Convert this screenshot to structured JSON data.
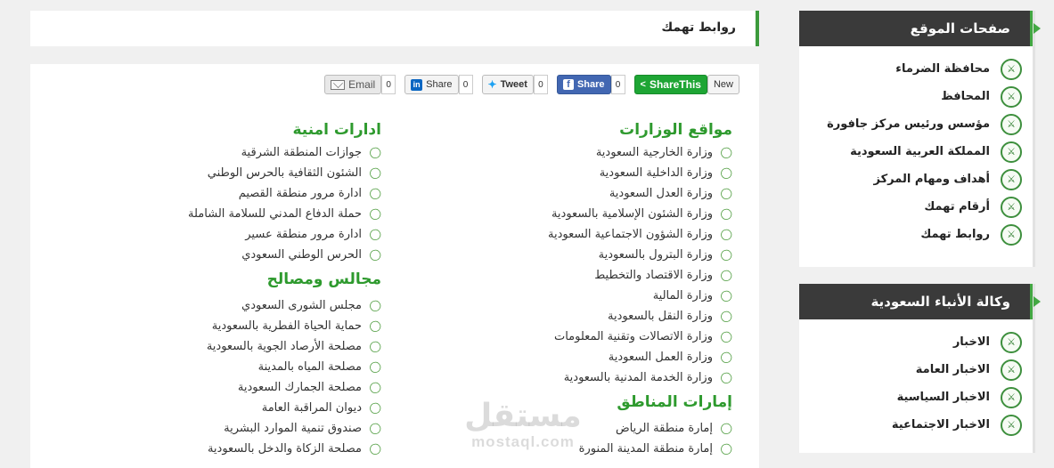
{
  "page": {
    "title": "روابط تهمك"
  },
  "share_bar": {
    "sharethis_label": "ShareThis",
    "new_label": "New",
    "facebook_label": "Share",
    "facebook_count": "0",
    "tweet_label": "Tweet",
    "tweet_count": "0",
    "linkedin_label": "Share",
    "linkedin_count": "0",
    "email_label": "Email",
    "email_count": "0"
  },
  "sections": {
    "ministries": {
      "title": "مواقع الوزارات",
      "items": [
        "وزارة الخارجية السعودية",
        "وزارة الداخلية السعودية",
        "وزارة العدل السعودية",
        "وزارة الشئون الإسلامية بالسعودية",
        "وزارة الشؤون الاجتماعية السعودية",
        "وزارة البترول بالسعودية",
        "وزارة الاقتصاد والتخطيط",
        "وزارة المالية",
        "وزارة النقل بالسعودية",
        "وزارة الاتصالات وتقنية المعلومات",
        "وزارة العمل السعودية",
        "وزارة الخدمة المدنية بالسعودية"
      ]
    },
    "regions": {
      "title": "إمارات المناطق",
      "items": [
        "إمارة منطقة الرياض",
        "إمارة منطقة المدينة المنورة"
      ]
    },
    "security": {
      "title": "ادارات امنية",
      "items": [
        "جوازات المنطقة الشرقية",
        "الشئون الثقافية بالحرس الوطني",
        "ادارة مرور منطقة القصيم",
        "حملة الدفاع المدني للسلامة الشاملة",
        "ادارة مرور منطقة عسير",
        "الحرس الوطني السعودي"
      ]
    },
    "councils": {
      "title": "مجالس ومصالح",
      "items": [
        "مجلس الشورى السعودي",
        "حماية الحياة الفطرية بالسعودية",
        "مصلحة الأرصاد الجوية بالسعودية",
        "مصلحة المياه بالمدينة",
        "مصلحة الجمارك السعودية",
        "ديوان المراقبة العامة",
        "صندوق تنمية الموارد البشرية",
        "مصلحة الزكاة والدخل بالسعودية"
      ]
    }
  },
  "sidebar": {
    "pages": {
      "title": "صفحات الموقع",
      "items": [
        "محافظة الضرماء",
        "المحافظ",
        "مؤسس ورئيس مركز جافورة",
        "المملكة العربية السعودية",
        "أهداف ومهام المركز",
        "أرقام تهمك",
        "روابط تهمك"
      ]
    },
    "news": {
      "title": "وكالة الأنباء السعودية",
      "items": [
        "الاخبار",
        "الاخبار العامة",
        "الاخبار السياسية",
        "الاخبار الاجتماعية"
      ]
    }
  },
  "watermark": {
    "arabic": "مستقل",
    "latin": "mostaql.com"
  },
  "icons": {
    "link": "paperclip-icon",
    "emblem": "saudi-emblem-icon"
  },
  "colors": {
    "accent": "#3c9a3c",
    "section_title": "#2e9a2e",
    "sidebar_header": "#3a3a3a"
  }
}
